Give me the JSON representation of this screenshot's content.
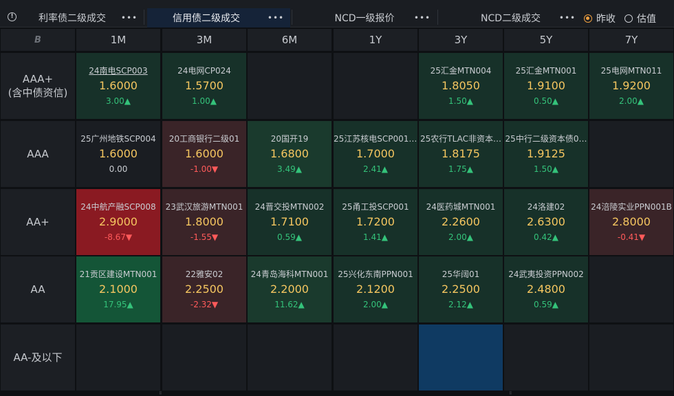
{
  "tabs": [
    {
      "label": "利率债二级成交",
      "active": false
    },
    {
      "label": "信用债二级成交",
      "active": true
    },
    {
      "label": "NCD一级报价",
      "active": false
    },
    {
      "label": "NCD二级成交",
      "active": false
    }
  ],
  "more_glyph": "•••",
  "radios": [
    {
      "label": "昨收",
      "selected": true
    },
    {
      "label": "估值",
      "selected": false
    }
  ],
  "corner_glyph": "B",
  "columns": [
    "1M",
    "3M",
    "6M",
    "1Y",
    "3Y",
    "5Y",
    "7Y"
  ],
  "rows": [
    {
      "label_line1": "AAA+",
      "label_line2": "(含中债资信)"
    },
    {
      "label_line1": "AAA",
      "label_line2": ""
    },
    {
      "label_line1": "AA+",
      "label_line2": ""
    },
    {
      "label_line1": "AA",
      "label_line2": ""
    },
    {
      "label_line1": "AA-及以下",
      "label_line2": ""
    }
  ],
  "cells": [
    [
      {
        "name": "24南电SCP003",
        "yield": "1.6000",
        "change": "3.00▲",
        "dir": "up",
        "tone": "g1",
        "link": true
      },
      {
        "name": "24电网CP024",
        "yield": "1.5700",
        "change": "1.00▲",
        "dir": "up",
        "tone": "g1"
      },
      {
        "tone": "empty"
      },
      {
        "tone": "empty"
      },
      {
        "name": "25汇金MTN004",
        "yield": "1.8050",
        "change": "1.50▲",
        "dir": "up",
        "tone": "g1"
      },
      {
        "name": "25汇金MTN001",
        "yield": "1.9100",
        "change": "0.50▲",
        "dir": "up",
        "tone": "g1"
      },
      {
        "name": "25电网MTN011",
        "yield": "1.9200",
        "change": "2.00▲",
        "dir": "up",
        "tone": "g1"
      }
    ],
    [
      {
        "name": "25广州地铁SCP004",
        "yield": "1.6000",
        "change": "0.00",
        "dir": "flat",
        "tone": "n"
      },
      {
        "name": "20工商银行二级01",
        "yield": "1.6000",
        "change": "-1.00▼",
        "dir": "dn",
        "tone": "r1"
      },
      {
        "name": "20国开19",
        "yield": "1.6800",
        "change": "3.49▲",
        "dir": "up",
        "tone": "g2"
      },
      {
        "name": "25江苏核电SCP001(…",
        "yield": "1.7000",
        "change": "2.41▲",
        "dir": "up",
        "tone": "g1"
      },
      {
        "name": "25农行TLAC非资本…",
        "yield": "1.8175",
        "change": "1.75▲",
        "dir": "up",
        "tone": "g1"
      },
      {
        "name": "25中行二级资本债0…",
        "yield": "1.9125",
        "change": "1.50▲",
        "dir": "up",
        "tone": "g1"
      },
      {
        "tone": "empty"
      }
    ],
    [
      {
        "name": "24中航产融SCP008",
        "yield": "2.9000",
        "change": "-8.67▼",
        "dir": "dn",
        "tone": "r2"
      },
      {
        "name": "23武汉旅游MTN001",
        "yield": "1.8000",
        "change": "-1.55▼",
        "dir": "dn",
        "tone": "r1"
      },
      {
        "name": "24晋交投MTN002",
        "yield": "1.7100",
        "change": "0.59▲",
        "dir": "up",
        "tone": "g1"
      },
      {
        "name": "25甬工投SCP001",
        "yield": "1.7200",
        "change": "1.41▲",
        "dir": "up",
        "tone": "g1"
      },
      {
        "name": "24医药城MTN001",
        "yield": "2.2600",
        "change": "2.00▲",
        "dir": "up",
        "tone": "g1"
      },
      {
        "name": "24洛建02",
        "yield": "2.6300",
        "change": "0.42▲",
        "dir": "up",
        "tone": "g1"
      },
      {
        "name": "24涪陵实业PPN001B",
        "yield": "2.8000",
        "change": "-0.41▼",
        "dir": "dn",
        "tone": "r1"
      }
    ],
    [
      {
        "name": "21贡区建设MTN001",
        "yield": "2.1000",
        "change": "17.95▲",
        "dir": "up",
        "tone": "g3"
      },
      {
        "name": "22雅安02",
        "yield": "2.2500",
        "change": "-2.32▼",
        "dir": "dn",
        "tone": "r1"
      },
      {
        "name": "24青岛海科MTN001",
        "yield": "2.2000",
        "change": "11.62▲",
        "dir": "up",
        "tone": "g2"
      },
      {
        "name": "25兴化东南PPN001",
        "yield": "2.1200",
        "change": "2.00▲",
        "dir": "up",
        "tone": "g1"
      },
      {
        "name": "25华阔01",
        "yield": "2.2500",
        "change": "2.12▲",
        "dir": "up",
        "tone": "g1"
      },
      {
        "name": "24武夷投资PPN002",
        "yield": "2.4800",
        "change": "0.59▲",
        "dir": "up",
        "tone": "g1"
      },
      {
        "tone": "empty"
      }
    ],
    [
      {
        "tone": "empty"
      },
      {
        "tone": "empty"
      },
      {
        "tone": "empty"
      },
      {
        "tone": "empty"
      },
      {
        "tone": "blue"
      },
      {
        "tone": "empty"
      },
      {
        "tone": "empty"
      }
    ]
  ],
  "colors": {
    "yield": "#f5c660",
    "up": "#34c27a",
    "down": "#ff5a5a",
    "active_tab": "#152338"
  }
}
